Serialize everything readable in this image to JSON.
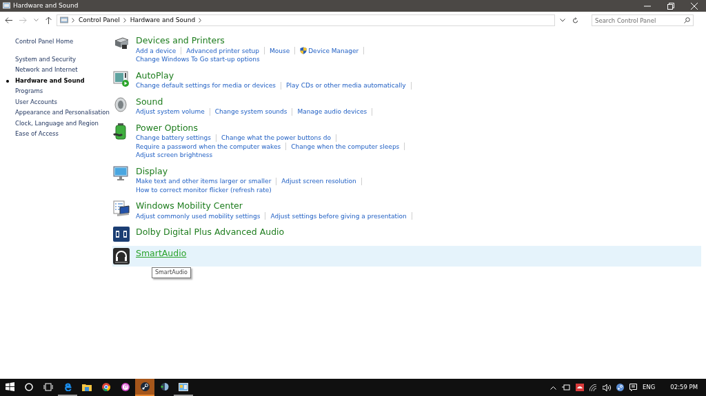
{
  "window": {
    "title": "Hardware and Sound"
  },
  "address_bar": {
    "breadcrumb": [
      "Control Panel",
      "Hardware and Sound"
    ]
  },
  "search": {
    "placeholder": "Search Control Panel"
  },
  "sidebar": {
    "items": [
      {
        "label": "Control Panel Home",
        "selected": false
      },
      {
        "label": "System and Security",
        "selected": false
      },
      {
        "label": "Network and Internet",
        "selected": false
      },
      {
        "label": "Hardware and Sound",
        "selected": true
      },
      {
        "label": "Programs",
        "selected": false
      },
      {
        "label": "User Accounts",
        "selected": false
      },
      {
        "label": "Appearance and Personalisation",
        "selected": false
      },
      {
        "label": "Clock, Language and Region",
        "selected": false
      },
      {
        "label": "Ease of Access",
        "selected": false
      }
    ]
  },
  "categories": [
    {
      "kind": "printer",
      "title": "Devices and Printers",
      "hovered": false,
      "lines": [
        [
          {
            "text": "Add a device"
          },
          {
            "text": "Advanced printer setup"
          },
          {
            "text": "Mouse"
          },
          {
            "text": "Device Manager",
            "shield": true
          }
        ],
        [
          {
            "text": "Change Windows To Go start-up options"
          }
        ]
      ]
    },
    {
      "kind": "autoplay",
      "title": "AutoPlay",
      "hovered": false,
      "lines": [
        [
          {
            "text": "Change default settings for media or devices"
          },
          {
            "text": "Play CDs or other media automatically"
          }
        ]
      ]
    },
    {
      "kind": "sound",
      "title": "Sound",
      "hovered": false,
      "lines": [
        [
          {
            "text": "Adjust system volume"
          },
          {
            "text": "Change system sounds"
          },
          {
            "text": "Manage audio devices"
          }
        ]
      ]
    },
    {
      "kind": "power",
      "title": "Power Options",
      "hovered": false,
      "lines": [
        [
          {
            "text": "Change battery settings"
          },
          {
            "text": "Change what the power buttons do"
          }
        ],
        [
          {
            "text": "Require a password when the computer wakes"
          },
          {
            "text": "Change when the computer sleeps"
          }
        ],
        [
          {
            "text": "Adjust screen brightness"
          }
        ]
      ]
    },
    {
      "kind": "display",
      "title": "Display",
      "hovered": false,
      "lines": [
        [
          {
            "text": "Make text and other items larger or smaller"
          },
          {
            "text": "Adjust screen resolution"
          }
        ],
        [
          {
            "text": "How to correct monitor flicker (refresh rate)"
          }
        ]
      ]
    },
    {
      "kind": "mobility",
      "title": "Windows Mobility Center",
      "hovered": false,
      "lines": [
        [
          {
            "text": "Adjust commonly used mobility settings"
          },
          {
            "text": "Adjust settings before giving a presentation"
          }
        ]
      ]
    },
    {
      "kind": "dolby",
      "title": "Dolby Digital Plus Advanced Audio",
      "hovered": false
    },
    {
      "kind": "headphones",
      "title": "SmartAudio",
      "hovered": true,
      "tooltip": "SmartAudio"
    }
  ],
  "taskbar": {
    "apps": [
      {
        "kind": "start",
        "selected": false,
        "running": false
      },
      {
        "kind": "cortana",
        "selected": false,
        "running": false
      },
      {
        "kind": "taskview",
        "selected": false,
        "running": false
      },
      {
        "kind": "edge",
        "selected": false,
        "running": true
      },
      {
        "kind": "explorer",
        "selected": false,
        "running": false
      },
      {
        "kind": "chrome",
        "selected": false,
        "running": false
      },
      {
        "kind": "itunes",
        "selected": false,
        "running": false
      },
      {
        "kind": "steam",
        "selected": true,
        "running": true
      },
      {
        "kind": "disc",
        "selected": false,
        "running": false
      },
      {
        "kind": "controlpanel",
        "selected": false,
        "running": true
      }
    ],
    "language": "ENG",
    "time": "02:59 PM"
  }
}
